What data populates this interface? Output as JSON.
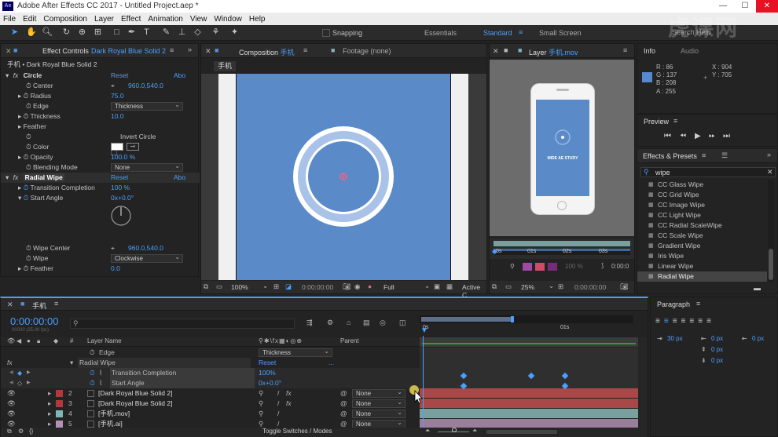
{
  "app": {
    "title": "Adobe After Effects CC 2017 - Untitled Project.aep *",
    "icon": "ae-logo-icon"
  },
  "menu": [
    "File",
    "Edit",
    "Composition",
    "Layer",
    "Effect",
    "Animation",
    "View",
    "Window",
    "Help"
  ],
  "toolbar": {
    "snapping": "Snapping",
    "workspaces": [
      "Essentials",
      "Standard",
      "Small Screen"
    ],
    "search_placeholder": "Search Help"
  },
  "effect_controls": {
    "tab": "Effect Controls",
    "tab_layer": "Dark Royal Blue Solid 2",
    "header": "手机 • Dark Royal Blue Solid 2",
    "circle": {
      "name": "Circle",
      "reset": "Reset",
      "about": "Abo",
      "center_label": "Center",
      "center_value": "960.0,540.0",
      "radius_label": "Radius",
      "radius_value": "75.0",
      "edge_label": "Edge",
      "edge_value": "Thickness",
      "thickness_label": "Thickness",
      "thickness_value": "10.0",
      "feather_label": "Feather",
      "invert_label": "Invert Circle",
      "color_label": "Color",
      "opacity_label": "Opacity",
      "opacity_value": "100.0 %",
      "blend_label": "Blending Mode",
      "blend_value": "None"
    },
    "radial": {
      "name": "Radial Wipe",
      "reset": "Reset",
      "about": "Abo",
      "completion_label": "Transition Completion",
      "completion_value": "100 %",
      "angle_label": "Start Angle",
      "angle_value": "0x+0.0°",
      "center_label": "Wipe Center",
      "center_value": "960.0,540.0",
      "wipe_label": "Wipe",
      "wipe_value": "Clockwise",
      "feather_label": "Feather",
      "feather_value": "0.0"
    }
  },
  "composition": {
    "tab": "Composition",
    "tab_name": "手机",
    "footage_tab": "Footage (none)",
    "subtab": "手机",
    "zoom": "100%",
    "timecode": "0:00:00:00",
    "quality": "Full",
    "camera": "Active C",
    "bg_color": "#5b8ac8"
  },
  "layer_panel": {
    "tab": "Layer",
    "tab_name": "手机.mov",
    "phone_text": "MIDE AE STUDY",
    "ruler": [
      "0s",
      "01s",
      "02s",
      "03s"
    ],
    "zoom": "25%",
    "timecode": "0:00:00:00",
    "end_time": "0:00:0",
    "opacity": "100 %"
  },
  "info": {
    "tab": "Info",
    "tab2": "Audio",
    "r": "R : 86",
    "g": "G : 137",
    "b": "B : 208",
    "a": "A : 255",
    "x": "X : 904",
    "y": "Y : 705",
    "swatch": "#5689d0"
  },
  "preview": {
    "tab": "Preview"
  },
  "effects_presets": {
    "tab": "Effects & Presets",
    "search": "wipe",
    "items": [
      "CC Glass Wipe",
      "CC Grid Wipe",
      "CC Image Wipe",
      "CC Light Wipe",
      "CC Radial ScaleWipe",
      "CC Scale Wipe",
      "Gradient Wipe",
      "Iris Wipe",
      "Linear Wipe",
      "Radial Wipe"
    ],
    "selected": 9
  },
  "paragraph": {
    "tab": "Paragraph",
    "indent_left": "30 px",
    "indent_first": "0 px",
    "indent_right": "0 px",
    "space_before": "0 px",
    "space_after": "0 px"
  },
  "timeline": {
    "tab": "手机",
    "timecode": "0:00:00:00",
    "fps": "00000 (25.00 fps)",
    "col_layer_name": "Layer Name",
    "col_parent": "Parent",
    "col_hash": "#",
    "ruler": [
      "0s",
      "01s"
    ],
    "edge_label": "Edge",
    "edge_value": "Thickness",
    "radial_label": "Radial Wipe",
    "radial_reset": "Reset",
    "radial_dots": "...",
    "completion_label": "Transition Completion",
    "completion_value": "100%",
    "angle_label": "Start Angle",
    "angle_value": "0x+0.0°",
    "fx": "fx",
    "layers": [
      {
        "num": "2",
        "name": "[Dark Royal Blue Solid 2]",
        "color": "#b03a3a",
        "parent": "None",
        "bar": "#a84848"
      },
      {
        "num": "3",
        "name": "[Dark Royal Blue Solid 2]",
        "color": "#b03a3a",
        "parent": "None",
        "bar": "#a84848"
      },
      {
        "num": "4",
        "name": "[手机.mov]",
        "color": "#7fb7b7",
        "parent": "None",
        "bar": "#7a9f9f"
      },
      {
        "num": "5",
        "name": "[手机.ai]",
        "color": "#b48fb4",
        "parent": "None",
        "bar": "#9a7f9a"
      }
    ],
    "toggle_label": "Toggle Switches / Modes"
  },
  "watermark": "虎课网"
}
